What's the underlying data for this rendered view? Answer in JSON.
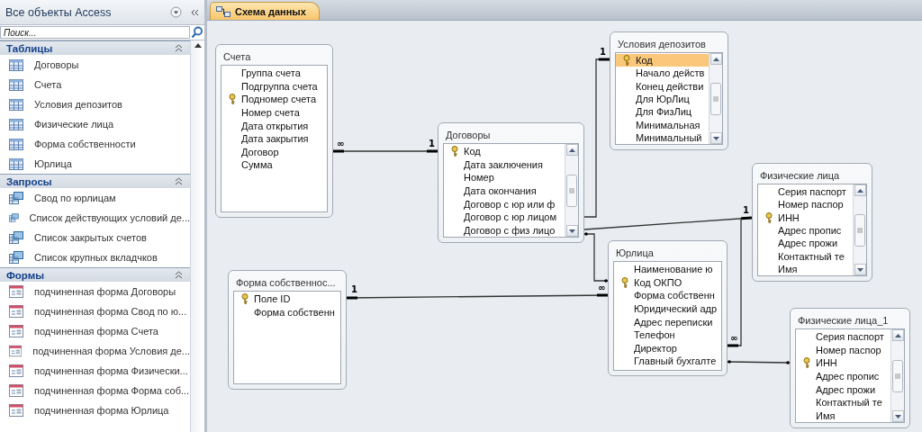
{
  "navigation_pane": {
    "title": "Все объекты Access",
    "search": {
      "placeholder": "Поиск..."
    },
    "groups": [
      {
        "title": "Таблицы",
        "kind": "table",
        "items": [
          "Договоры",
          "Счета",
          "Условия депозитов",
          "Физические лица",
          "Форма собственности",
          "Юрлица"
        ]
      },
      {
        "title": "Запросы",
        "kind": "query",
        "items": [
          "Свод по юрлицам",
          "Список действующих условий де...",
          "Список закрытых счетов",
          "Список крупных вкладчков"
        ]
      },
      {
        "title": "Формы",
        "kind": "form",
        "items": [
          "подчиненная форма Договоры",
          "подчиненная форма Свод по ю...",
          "подчиненная форма Счета",
          "подчиненная форма Условия де...",
          "подчиненная форма Физически...",
          "подчиненная форма Форма соб...",
          "подчиненная форма Юрлица"
        ]
      }
    ]
  },
  "tabs": [
    {
      "label": "Схема данных",
      "selected": true
    }
  ],
  "diagram": {
    "tables": [
      {
        "title": "Счета",
        "scrollbar": false,
        "fields": [
          {
            "name": "Группа счета",
            "key": false,
            "selected": false
          },
          {
            "name": "Подгруппа счета",
            "key": false,
            "selected": false
          },
          {
            "name": "Подномер счета",
            "key": true,
            "selected": false
          },
          {
            "name": "Номер счета",
            "key": false,
            "selected": false
          },
          {
            "name": "Дата открытия",
            "key": false,
            "selected": false
          },
          {
            "name": "Дата закрытия",
            "key": false,
            "selected": false
          },
          {
            "name": "Договор",
            "key": false,
            "selected": false
          },
          {
            "name": "Сумма",
            "key": false,
            "selected": false
          }
        ]
      },
      {
        "title": "Договоры",
        "scrollbar": true,
        "fields": [
          {
            "name": "Код",
            "key": true,
            "selected": false
          },
          {
            "name": "Дата заключения",
            "key": false,
            "selected": false
          },
          {
            "name": "Номер",
            "key": false,
            "selected": false
          },
          {
            "name": "Дата окончания",
            "key": false,
            "selected": false
          },
          {
            "name": "Договор с юр или ф",
            "key": false,
            "selected": false
          },
          {
            "name": "Договор с юр лицом",
            "key": false,
            "selected": false
          },
          {
            "name": "Договор с физ лицо",
            "key": false,
            "selected": false
          }
        ]
      },
      {
        "title": "Условия депозитов",
        "scrollbar": true,
        "fields": [
          {
            "name": "Код",
            "key": true,
            "selected": true
          },
          {
            "name": "Начало действ",
            "key": false,
            "selected": false
          },
          {
            "name": "Конец действи",
            "key": false,
            "selected": false
          },
          {
            "name": "Для ЮрЛиц",
            "key": false,
            "selected": false
          },
          {
            "name": "Для ФизЛиц",
            "key": false,
            "selected": false
          },
          {
            "name": "Минимальная",
            "key": false,
            "selected": false
          },
          {
            "name": "Минимальный",
            "key": false,
            "selected": false
          }
        ]
      },
      {
        "title": "Физические лица",
        "scrollbar": true,
        "fields": [
          {
            "name": "Серия паспорт",
            "key": false,
            "selected": false
          },
          {
            "name": "Номер паспор",
            "key": false,
            "selected": false
          },
          {
            "name": "ИНН",
            "key": true,
            "selected": false
          },
          {
            "name": "Адрес пропис",
            "key": false,
            "selected": false
          },
          {
            "name": "Адрес прожи",
            "key": false,
            "selected": false
          },
          {
            "name": "Контактный те",
            "key": false,
            "selected": false
          },
          {
            "name": "Имя",
            "key": false,
            "selected": false
          }
        ]
      },
      {
        "title": "Юрлица",
        "scrollbar": false,
        "fields": [
          {
            "name": "Наименование ю",
            "key": false,
            "selected": false
          },
          {
            "name": "Код ОКПО",
            "key": true,
            "selected": false
          },
          {
            "name": "Форма собственн",
            "key": false,
            "selected": false
          },
          {
            "name": "Юридический адр",
            "key": false,
            "selected": false
          },
          {
            "name": "Адрес переписки",
            "key": false,
            "selected": false
          },
          {
            "name": "Телефон",
            "key": false,
            "selected": false
          },
          {
            "name": "Директор",
            "key": false,
            "selected": false
          },
          {
            "name": "Главный бухгалте",
            "key": false,
            "selected": false
          }
        ]
      },
      {
        "title": "Форма собственнос...",
        "scrollbar": false,
        "fields": [
          {
            "name": "Поле ID",
            "key": true,
            "selected": false
          },
          {
            "name": "Форма собственн",
            "key": false,
            "selected": false
          }
        ]
      },
      {
        "title": "Физические лица_1",
        "scrollbar": true,
        "fields": [
          {
            "name": "Серия паспорт",
            "key": false,
            "selected": false
          },
          {
            "name": "Номер паспор",
            "key": false,
            "selected": false
          },
          {
            "name": "ИНН",
            "key": true,
            "selected": false
          },
          {
            "name": "Адрес пропис",
            "key": false,
            "selected": false
          },
          {
            "name": "Адрес прожи",
            "key": false,
            "selected": false
          },
          {
            "name": "Контактный те",
            "key": false,
            "selected": false
          },
          {
            "name": "Имя",
            "key": false,
            "selected": false
          }
        ]
      }
    ],
    "relationships": [
      {
        "kind": "enforced",
        "start_label": "∞",
        "end_label": "1"
      },
      {
        "kind": "enforced",
        "end_label": "1"
      },
      {
        "kind": "enforced",
        "end_label": "1"
      },
      {
        "kind": "plain"
      },
      {
        "kind": "enforced",
        "start_label": "1",
        "end_label": "∞"
      },
      {
        "kind": "enforced",
        "end_label": "∞"
      },
      {
        "kind": "plain"
      }
    ]
  }
}
